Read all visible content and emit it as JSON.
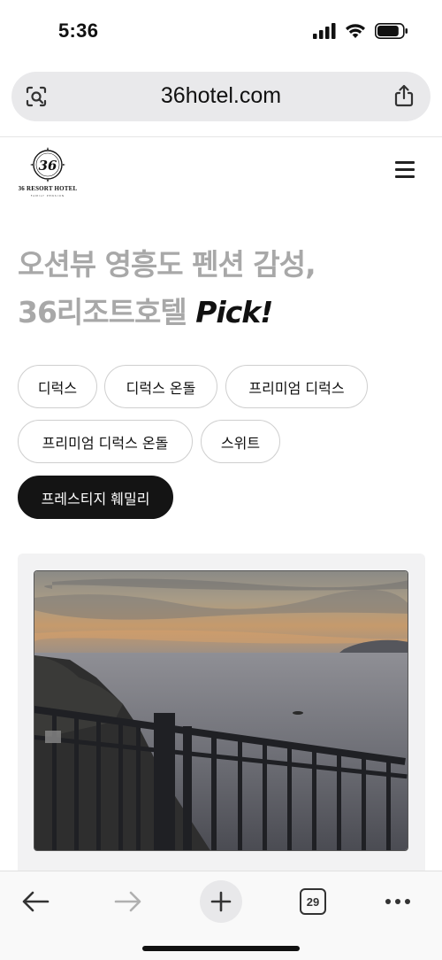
{
  "status_bar": {
    "time": "5:36",
    "battery_percent": 85
  },
  "browser": {
    "url": "36hotel.com",
    "tab_count": "29"
  },
  "header": {
    "logo_name": "36 RESORT HOTEL",
    "logo_sub": "FAMILY PENSION",
    "logo_mark": "36"
  },
  "hero": {
    "line1": "오션뷰 영흥도 펜션 감성,",
    "line2_gray": "36리조트호텔",
    "line2_black": "Pick!"
  },
  "room_chips": [
    {
      "label": "디럭스",
      "selected": false
    },
    {
      "label": "디럭스 온돌",
      "selected": false
    },
    {
      "label": "프리미엄 디럭스",
      "selected": false
    },
    {
      "label": "프리미엄 디럭스 온돌",
      "selected": false
    },
    {
      "label": "스위트",
      "selected": false
    },
    {
      "label": "프레스티지 훼밀리",
      "selected": true
    }
  ],
  "colors": {
    "accent": "#141414",
    "hero_gray": "#a8a8a8",
    "url_bar_bg": "#e9e9eb",
    "card_bg": "#f2f2f3"
  }
}
